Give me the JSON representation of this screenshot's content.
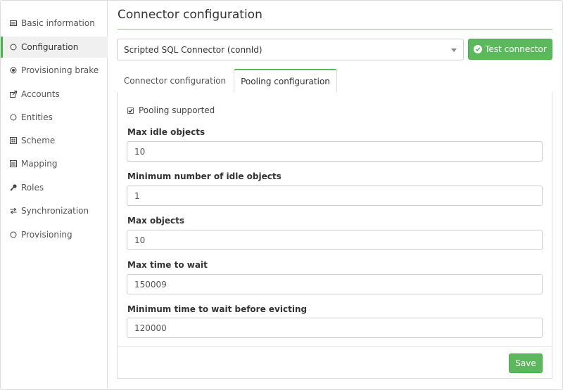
{
  "sidebar": {
    "items": [
      {
        "label": "Basic information",
        "icon": "id-card-icon"
      },
      {
        "label": "Configuration",
        "icon": "circle-icon"
      },
      {
        "label": "Provisioning brake",
        "icon": "dot-circle-icon"
      },
      {
        "label": "Accounts",
        "icon": "external-link-icon"
      },
      {
        "label": "Entities",
        "icon": "circle-icon"
      },
      {
        "label": "Scheme",
        "icon": "grid-icon"
      },
      {
        "label": "Mapping",
        "icon": "list-icon"
      },
      {
        "label": "Roles",
        "icon": "key-icon"
      },
      {
        "label": "Synchronization",
        "icon": "exchange-icon"
      },
      {
        "label": "Provisioning",
        "icon": "circle-icon"
      }
    ],
    "active_index": 1
  },
  "header": {
    "title": "Connector configuration"
  },
  "connector_select": {
    "value": "Scripted SQL Connector (connId)"
  },
  "test_button": {
    "label": "Test connector"
  },
  "tabs": [
    {
      "label": "Connector configuration",
      "active": false
    },
    {
      "label": "Pooling configuration",
      "active": true
    }
  ],
  "form": {
    "pooling_supported": {
      "label": "Pooling supported",
      "checked": true
    },
    "fields": [
      {
        "label": "Max idle objects",
        "value": "10"
      },
      {
        "label": "Minimum number of idle objects",
        "value": "1"
      },
      {
        "label": "Max objects",
        "value": "10"
      },
      {
        "label": "Max time to wait",
        "value": "150009"
      },
      {
        "label": "Minimum time to wait before evicting",
        "value": "120000"
      }
    ]
  },
  "save_button": {
    "label": "Save"
  },
  "colors": {
    "accent": "#5cb85c",
    "accent_border": "#4cae4c"
  }
}
